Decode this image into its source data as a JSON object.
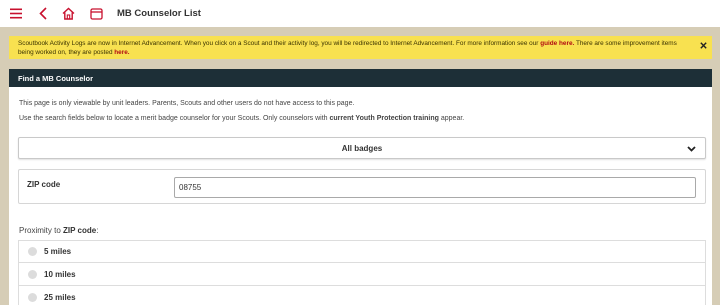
{
  "header": {
    "title": "MB Counselor List",
    "icons": [
      "menu-icon",
      "back-icon",
      "home-icon",
      "window-icon"
    ]
  },
  "alert": {
    "text_before": "Scoutbook Activity Logs are now in Internet Advancement. When you click on a Scout and their activity log, you will be redirected to Internet Advancement. For more information see our ",
    "link1": "guide here.",
    "text_middle": " There are some improvement items being worked on, they are posted ",
    "link2": "here."
  },
  "panel": {
    "title": "Find a MB Counselor",
    "notice": "This page is only viewable by unit leaders. Parents, Scouts and other users do not have access to this page.",
    "instructions_before": "Use the search fields below to locate a merit badge counselor for your Scouts. Only counselors with ",
    "instructions_bold": "current Youth Protection training",
    "instructions_after": " appear."
  },
  "badge_select": {
    "selected": "All badges"
  },
  "zip": {
    "label": "ZIP code",
    "value": "08755"
  },
  "proximity": {
    "label_prefix": "Proximity to ",
    "label_bold": "ZIP code",
    "label_suffix": ":",
    "options": [
      "5 miles",
      "10 miles",
      "25 miles"
    ]
  },
  "colors": {
    "accent": "#c8102e",
    "alert_bg": "#f8e150",
    "panel_header": "#1d2f37",
    "page_bg": "#d6cdb6"
  }
}
